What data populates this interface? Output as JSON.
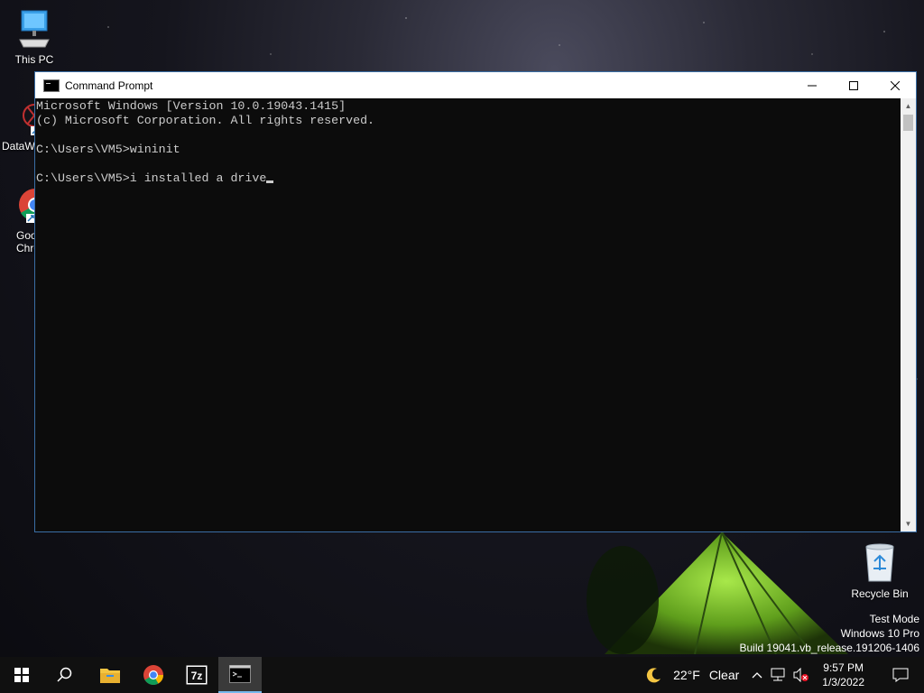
{
  "desktop": {
    "icons": [
      {
        "label": "This PC"
      },
      {
        "label": "DataW"
      },
      {
        "label": "Goo\nChro"
      },
      {
        "label": "Recycle Bin"
      }
    ],
    "watermark": {
      "line1": "Test Mode",
      "line2": "Windows 10 Pro",
      "line3": "Build 19041.vb_release.191206-1406"
    }
  },
  "window": {
    "title": "Command Prompt",
    "buttons": {
      "minimize": "—",
      "maximize": "☐",
      "close": "✕"
    },
    "console_lines": [
      "Microsoft Windows [Version 10.0.19043.1415]",
      "(c) Microsoft Corporation. All rights reserved.",
      "",
      "C:\\Users\\VM5>wininit",
      "",
      "C:\\Users\\VM5>i installed a drive"
    ]
  },
  "taskbar": {
    "weather": {
      "temp": "22°F",
      "condition": "Clear"
    },
    "clock": {
      "time": "9:57 PM",
      "date": "1/3/2022"
    },
    "pinned": [
      "start",
      "search",
      "file-explorer",
      "chrome",
      "7zip",
      "command-prompt"
    ]
  },
  "colors": {
    "accent": "#76b9ed",
    "console_bg": "#0c0c0c",
    "console_fg": "#cccccc",
    "taskbar": "#101010"
  }
}
